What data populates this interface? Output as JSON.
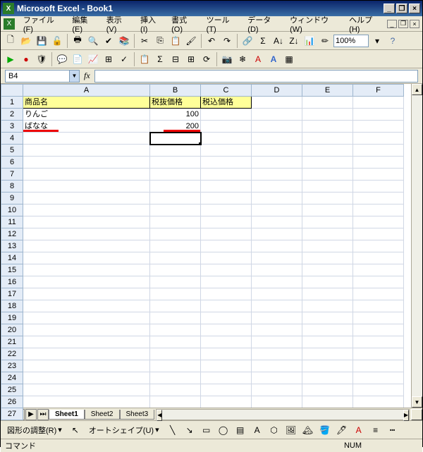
{
  "title": "Microsoft Excel - Book1",
  "menu": [
    "ファイル(F)",
    "編集(E)",
    "表示(V)",
    "挿入(I)",
    "書式(O)",
    "ツール(T)",
    "データ(D)",
    "ウィンドウ(W)",
    "ヘルプ(H)"
  ],
  "zoom": "100%",
  "namebox": "B4",
  "formula": "",
  "columns": [
    "A",
    "B",
    "C",
    "D",
    "E",
    "F"
  ],
  "rows_count": 27,
  "headers": {
    "A": "商品名",
    "B": "税抜価格",
    "C": "税込価格"
  },
  "data": [
    {
      "A": "りんご",
      "B": "100"
    },
    {
      "A": "ばなな",
      "B": "200"
    }
  ],
  "selected_cell": "B4",
  "sheets": [
    "Sheet1",
    "Sheet2",
    "Sheet3"
  ],
  "active_sheet": 0,
  "drawing_label": "図形の調整(R)",
  "autoshape_label": "オートシェイプ(U)",
  "status": "コマンド",
  "status_num": "NUM",
  "chart_data": {
    "type": "table",
    "columns": [
      "商品名",
      "税抜価格",
      "税込価格"
    ],
    "rows": [
      [
        "りんご",
        100,
        null
      ],
      [
        "ばなな",
        200,
        null
      ]
    ]
  }
}
